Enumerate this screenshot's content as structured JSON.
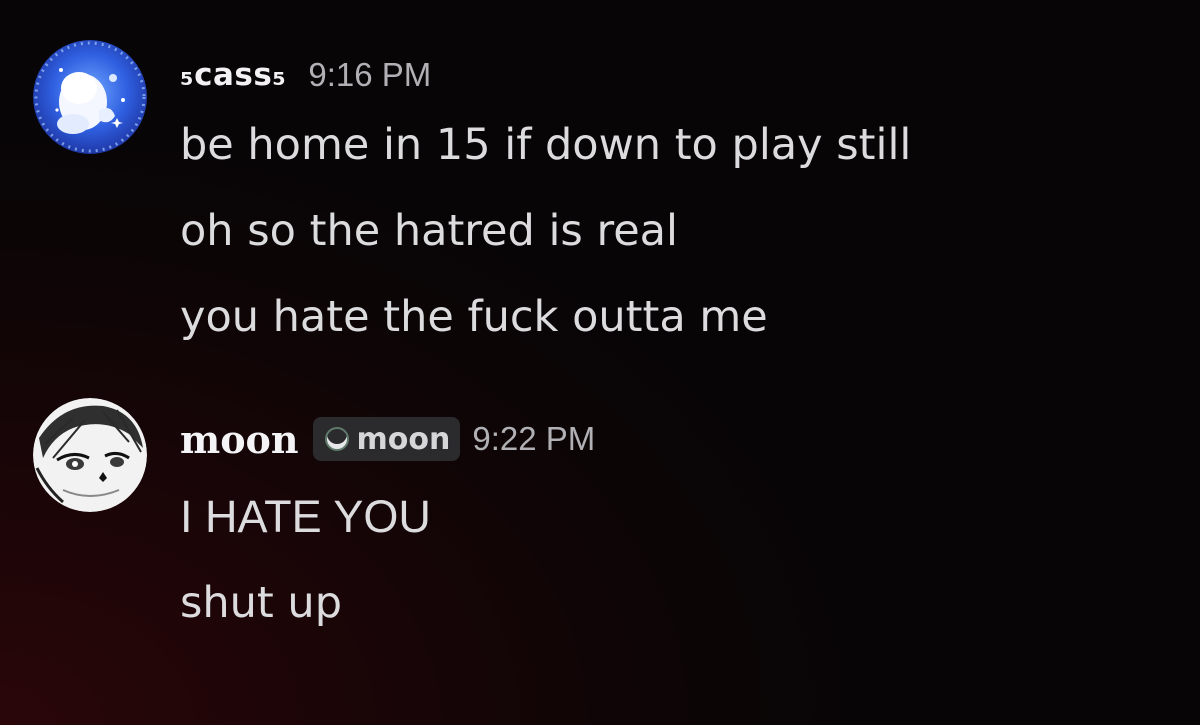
{
  "messages": [
    {
      "author": "₅cass₅",
      "timestamp": "9:16 PM",
      "lines": [
        "be home in 15 if down to play still",
        "oh so the hatred is real",
        "you hate the fuck outta me"
      ]
    },
    {
      "author": "moon",
      "tag": "moon",
      "timestamp": "9:22 PM",
      "lines": [
        "I HATE YOU",
        "shut up"
      ]
    }
  ],
  "colors": {
    "background_dark": "#070506",
    "background_red": "#2a0609",
    "text_primary": "#dcdcdf",
    "text_muted": "#b0b0b5",
    "tag_background": "#2b2b2e"
  },
  "icons": {
    "cass_avatar": "blue-anime-avatar",
    "moon_avatar": "manga-girl-avatar",
    "tag_icon": "crescent-moon-icon"
  }
}
